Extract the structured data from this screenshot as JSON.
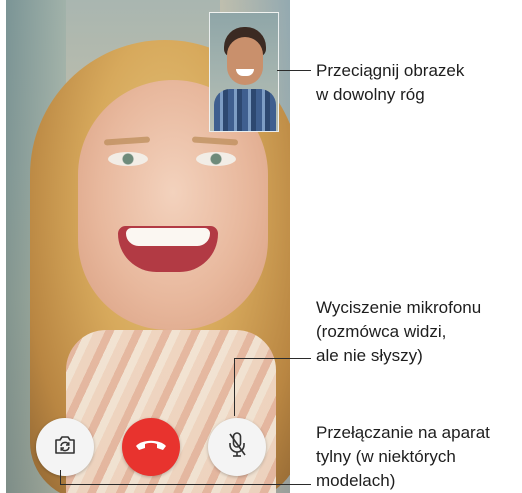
{
  "callouts": {
    "pip_drag": "Przeciągnij obrazek\nw dowolny róg",
    "mute": "Wyciszenie mikrofonu\n(rozmówca widzi,\nale nie słyszy)",
    "flip_camera": "Przełączanie na aparat\ntylny (w niektórych\nmodelach)"
  },
  "controls": {
    "flip_camera_icon": "camera-flip-icon",
    "end_call_icon": "phone-hangup-icon",
    "mute_icon": "microphone-mute-icon"
  },
  "colors": {
    "end_call": "#e8332e",
    "control_bg": "#f4f4f4"
  }
}
